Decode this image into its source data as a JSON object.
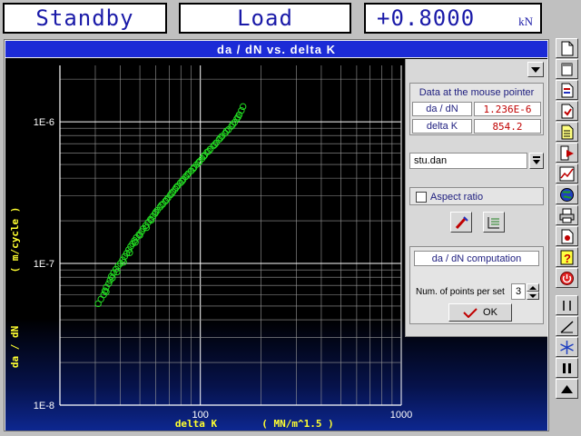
{
  "status": {
    "mode": "Standby",
    "channel": "Load",
    "value": "+0.8000",
    "unit": "kN"
  },
  "window": {
    "title": "da / dN  vs.  delta K"
  },
  "chart_data": {
    "type": "scatter",
    "xscale": "log",
    "yscale": "log",
    "xlim": [
      20,
      1000
    ],
    "ylim": [
      1e-08,
      2.5e-06
    ],
    "x_tick_labels": [
      "100",
      "1000"
    ],
    "y_tick_labels": [
      "1E-8",
      "1E-7",
      "1E-6"
    ],
    "xlabel": "delta K",
    "xunit": "( MN/m^1.5 )",
    "ylabel": "da / dN",
    "yunit": "( m/cycle )",
    "grid": true,
    "marker_color": "#22dd22",
    "points": [
      [
        31,
        5.2e-08
      ],
      [
        32,
        5.6e-08
      ],
      [
        33,
        6e-08
      ],
      [
        33.5,
        6.4e-08
      ],
      [
        34,
        6.8e-08
      ],
      [
        35,
        7.2e-08
      ],
      [
        35.5,
        7.6e-08
      ],
      [
        36,
        8.1e-08
      ],
      [
        37,
        8.6e-08
      ],
      [
        38,
        9.1e-08
      ],
      [
        39,
        9.6e-08
      ],
      [
        40,
        1e-07
      ],
      [
        41,
        1.06e-07
      ],
      [
        42,
        1.12e-07
      ],
      [
        43,
        1.18e-07
      ],
      [
        44,
        1.25e-07
      ],
      [
        45,
        1.32e-07
      ],
      [
        46,
        1.38e-07
      ],
      [
        47,
        1.45e-07
      ],
      [
        48,
        1.52e-07
      ],
      [
        49.5,
        1.6e-07
      ],
      [
        51,
        1.68e-07
      ],
      [
        52,
        1.76e-07
      ],
      [
        53.5,
        1.85e-07
      ],
      [
        55,
        1.95e-07
      ],
      [
        56.5,
        2.05e-07
      ],
      [
        58,
        2.15e-07
      ],
      [
        59.5,
        2.25e-07
      ],
      [
        61,
        2.37e-07
      ],
      [
        63,
        2.5e-07
      ],
      [
        65,
        2.62e-07
      ],
      [
        67,
        2.75e-07
      ],
      [
        69,
        2.9e-07
      ],
      [
        71,
        3.05e-07
      ],
      [
        73,
        3.2e-07
      ],
      [
        75,
        3.35e-07
      ],
      [
        77,
        3.52e-07
      ],
      [
        79.5,
        3.7e-07
      ],
      [
        82,
        3.9e-07
      ],
      [
        84.5,
        4.1e-07
      ],
      [
        87,
        4.3e-07
      ],
      [
        90,
        4.5e-07
      ],
      [
        93,
        4.75e-07
      ],
      [
        96,
        5e-07
      ],
      [
        99,
        5.25e-07
      ],
      [
        102,
        5.5e-07
      ],
      [
        105,
        5.8e-07
      ],
      [
        108,
        6.1e-07
      ],
      [
        112,
        6.4e-07
      ],
      [
        116,
        6.75e-07
      ],
      [
        120,
        7.1e-07
      ],
      [
        124,
        7.5e-07
      ],
      [
        128,
        7.9e-07
      ],
      [
        133,
        8.3e-07
      ],
      [
        138,
        8.8e-07
      ],
      [
        143,
        9.3e-07
      ],
      [
        148,
        9.9e-07
      ],
      [
        152,
        1.05e-06
      ],
      [
        156,
        1.12e-06
      ],
      [
        160,
        1.2e-06
      ],
      [
        163,
        1.28e-06
      ],
      [
        34,
        6.3e-08
      ],
      [
        36.5,
        7.9e-08
      ],
      [
        38.5,
        8.7e-08
      ],
      [
        41.5,
        1.02e-07
      ],
      [
        44.5,
        1.19e-07
      ],
      [
        47.5,
        1.41e-07
      ],
      [
        50,
        1.58e-07
      ],
      [
        54,
        1.79e-07
      ],
      [
        57,
        2.02e-07
      ],
      [
        60,
        2.3e-07
      ],
      [
        64,
        2.58e-07
      ],
      [
        68,
        2.82e-07
      ],
      [
        72,
        3.12e-07
      ],
      [
        76,
        3.45e-07
      ],
      [
        81,
        3.8e-07
      ],
      [
        86,
        4.2e-07
      ],
      [
        92,
        4.65e-07
      ],
      [
        98,
        5.15e-07
      ],
      [
        104,
        5.7e-07
      ],
      [
        110,
        6.2e-07
      ],
      [
        118,
        6.9e-07
      ],
      [
        126,
        7.7e-07
      ],
      [
        135,
        8.6e-07
      ],
      [
        145,
        9.6e-07
      ],
      [
        154,
        1.08e-06
      ]
    ]
  },
  "panel": {
    "mouse_title": "Data at the mouse pointer",
    "dadn_label": "da / dN",
    "dadn_value": "1.236E-6",
    "deltak_label": "delta K",
    "deltak_value": "854.2",
    "file": "stu.dan",
    "aspect_ratio": "Aspect ratio",
    "computation_title": "da / dN computation",
    "points_label": "Num. of points per set",
    "points_value": "3",
    "ok_label": "OK"
  }
}
